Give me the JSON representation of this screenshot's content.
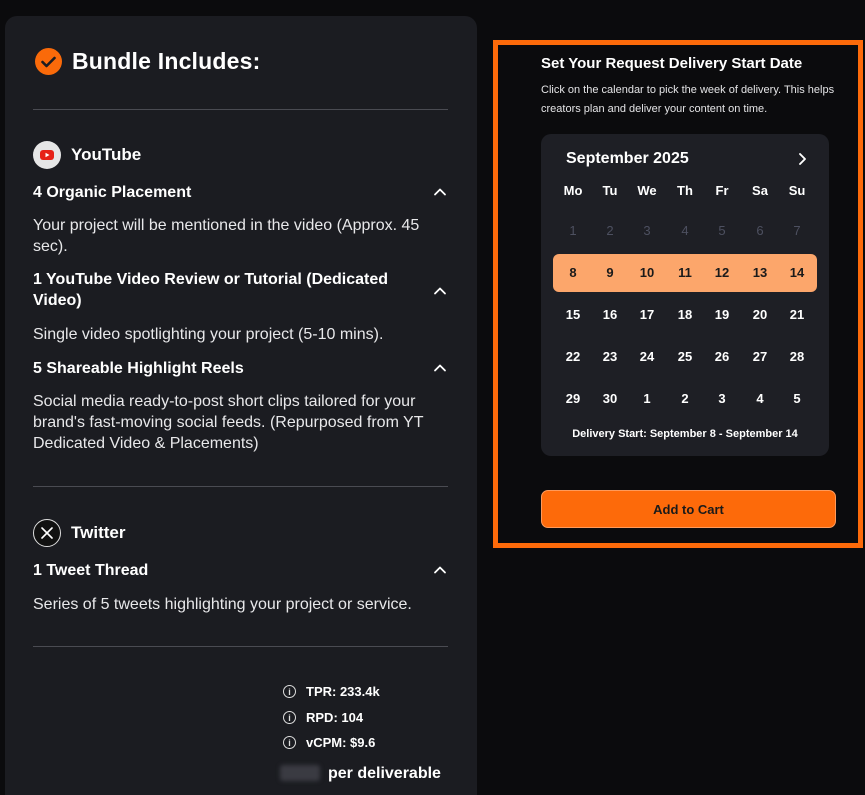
{
  "bundle": {
    "title": "Bundle Includes:",
    "youtube": {
      "name": "YouTube",
      "items": [
        {
          "title": "4 Organic Placement",
          "desc": "Your project will be mentioned in the video (Approx. 45 sec)."
        },
        {
          "title": "1 YouTube Video Review or Tutorial (Dedicated Video)",
          "desc": "Single video spotlighting your project (5-10 mins)."
        },
        {
          "title": "5 Shareable Highlight Reels",
          "desc": "Social media ready-to-post short clips tailored for your brand's fast-moving social feeds. (Repurposed from YT Dedicated Video & Placements)"
        }
      ]
    },
    "twitter": {
      "name": "Twitter",
      "items": [
        {
          "title": "1 Tweet Thread",
          "desc": "Series of 5 tweets highlighting your project or service."
        }
      ]
    },
    "stats": [
      "TPR: 233.4k",
      "RPD: 104",
      "vCPM: $9.6"
    ],
    "price_suffix": "per deliverable"
  },
  "delivery": {
    "title": "Set Your Request Delivery Start Date",
    "subtitle": "Click on the calendar to pick the week of delivery. This helps creators plan and deliver your content on time.",
    "calendar": {
      "month": "September 2025",
      "weekdays": [
        "Mo",
        "Tu",
        "We",
        "Th",
        "Fr",
        "Sa",
        "Su"
      ],
      "weeks": [
        [
          "1",
          "2",
          "3",
          "4",
          "5",
          "6",
          "7"
        ],
        [
          "8",
          "9",
          "10",
          "11",
          "12",
          "13",
          "14"
        ],
        [
          "15",
          "16",
          "17",
          "18",
          "19",
          "20",
          "21"
        ],
        [
          "22",
          "23",
          "24",
          "25",
          "26",
          "27",
          "28"
        ],
        [
          "29",
          "30",
          "1",
          "2",
          "3",
          "4",
          "5"
        ]
      ],
      "delivery_start": "Delivery Start: September 8 - September 14"
    },
    "cta": "Add to Cart"
  },
  "colors": {
    "accent": "#fd6a0a",
    "highlight": "#fca66b",
    "panel": "#1b1c21"
  }
}
